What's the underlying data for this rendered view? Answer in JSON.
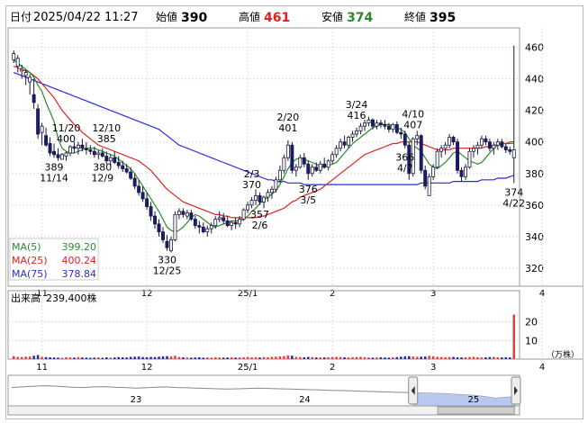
{
  "header": {
    "date_label": "日付",
    "date_value": "2025/04/22 11:27",
    "open_label": "始値",
    "open_value": "390",
    "high_label": "高値",
    "high_value": "461",
    "low_label": "安値",
    "low_value": "374",
    "close_label": "終値",
    "close_value": "395"
  },
  "colors": {
    "up": "#ffffff",
    "down": "#1a1a7a",
    "ma5": "#2a8a2a",
    "ma25": "#e02020",
    "ma75": "#2a2ae0",
    "high_text": "#e02020",
    "low_text": "#2a8a2a",
    "vol_up": "#e04040",
    "vol_down": "#2a2a9a",
    "nav_fill": "#b8c8f0"
  },
  "legend": [
    {
      "name": "MA(5)",
      "value": "399.20"
    },
    {
      "name": "MA(25)",
      "value": "400.24"
    },
    {
      "name": "MA(75)",
      "value": "378.84"
    }
  ],
  "volume_label": "出来高",
  "volume_value": "239,400株",
  "volume_unit": "（万株）",
  "month_ticks": [
    "11",
    "12",
    "25/1",
    "2",
    "3",
    "4"
  ],
  "nav_ticks": [
    "23",
    "24",
    "25"
  ],
  "chart_data": {
    "type": "candlestick",
    "ylim": [
      312,
      470
    ],
    "yticks": [
      320,
      340,
      360,
      380,
      400,
      420,
      440,
      460
    ],
    "volume_ylim": [
      0,
      30
    ],
    "volume_yticks": [
      10,
      20
    ],
    "month_start_index": [
      7,
      33,
      58,
      79,
      104,
      131
    ],
    "ohlc": [
      [
        452,
        458,
        450,
        456
      ],
      [
        448,
        455,
        444,
        453
      ],
      [
        445,
        449,
        440,
        446
      ],
      [
        442,
        446,
        436,
        444
      ],
      [
        438,
        443,
        430,
        441
      ],
      [
        430,
        440,
        421,
        425
      ],
      [
        421,
        424,
        402,
        405
      ],
      [
        406,
        412,
        398,
        410
      ],
      [
        404,
        409,
        397,
        398
      ],
      [
        399,
        403,
        391,
        393
      ],
      [
        394,
        399,
        390,
        392
      ],
      [
        392,
        396,
        388,
        390
      ],
      [
        389,
        393,
        389,
        392
      ],
      [
        391,
        394,
        388,
        393
      ],
      [
        393,
        398,
        391,
        397
      ],
      [
        397,
        400,
        393,
        396
      ],
      [
        396,
        400,
        392,
        398
      ],
      [
        398,
        402,
        394,
        396
      ],
      [
        396,
        400,
        392,
        395
      ],
      [
        395,
        398,
        392,
        394
      ],
      [
        394,
        397,
        390,
        392
      ],
      [
        392,
        395,
        389,
        393
      ],
      [
        393,
        396,
        390,
        391
      ],
      [
        391,
        394,
        386,
        388
      ],
      [
        388,
        392,
        385,
        390
      ],
      [
        390,
        394,
        386,
        387
      ],
      [
        387,
        391,
        383,
        385
      ],
      [
        385,
        388,
        381,
        383
      ],
      [
        383,
        386,
        380,
        381
      ],
      [
        381,
        384,
        376,
        377
      ],
      [
        377,
        380,
        370,
        372
      ],
      [
        372,
        376,
        366,
        368
      ],
      [
        368,
        372,
        362,
        364
      ],
      [
        364,
        368,
        357,
        359
      ],
      [
        359,
        362,
        350,
        353
      ],
      [
        353,
        356,
        345,
        348
      ],
      [
        348,
        351,
        340,
        343
      ],
      [
        343,
        346,
        336,
        338
      ],
      [
        337,
        341,
        331,
        333
      ],
      [
        331,
        340,
        330,
        338
      ],
      [
        338,
        356,
        337,
        354
      ],
      [
        354,
        358,
        351,
        356
      ],
      [
        356,
        358,
        352,
        354
      ],
      [
        353,
        357,
        351,
        355
      ],
      [
        355,
        357,
        350,
        351
      ],
      [
        351,
        353,
        345,
        347
      ],
      [
        347,
        350,
        342,
        346
      ],
      [
        346,
        349,
        342,
        343
      ],
      [
        343,
        347,
        340,
        345
      ],
      [
        345,
        349,
        342,
        347
      ],
      [
        347,
        353,
        345,
        351
      ],
      [
        351,
        356,
        349,
        352
      ],
      [
        352,
        355,
        348,
        350
      ],
      [
        350,
        353,
        346,
        347
      ],
      [
        347,
        350,
        344,
        349
      ],
      [
        349,
        352,
        345,
        348
      ],
      [
        348,
        353,
        346,
        351
      ],
      [
        351,
        358,
        350,
        357
      ],
      [
        357,
        362,
        355,
        360
      ],
      [
        360,
        365,
        358,
        363
      ],
      [
        363,
        370,
        360,
        366
      ],
      [
        366,
        368,
        360,
        362
      ],
      [
        362,
        366,
        358,
        365
      ],
      [
        365,
        370,
        362,
        368
      ],
      [
        368,
        372,
        364,
        370
      ],
      [
        370,
        378,
        368,
        376
      ],
      [
        376,
        385,
        374,
        382
      ],
      [
        382,
        392,
        380,
        390
      ],
      [
        390,
        401,
        388,
        398
      ],
      [
        398,
        400,
        380,
        382
      ],
      [
        382,
        386,
        378,
        384
      ],
      [
        384,
        392,
        383,
        390
      ],
      [
        390,
        393,
        384,
        386
      ],
      [
        386,
        388,
        376,
        380
      ],
      [
        380,
        386,
        378,
        384
      ],
      [
        384,
        387,
        381,
        382
      ],
      [
        382,
        388,
        380,
        386
      ],
      [
        386,
        390,
        383,
        384
      ],
      [
        384,
        389,
        382,
        388
      ],
      [
        388,
        394,
        386,
        392
      ],
      [
        392,
        398,
        390,
        396
      ],
      [
        396,
        402,
        394,
        400
      ],
      [
        400,
        404,
        396,
        398
      ],
      [
        398,
        404,
        396,
        403
      ],
      [
        403,
        407,
        400,
        405
      ],
      [
        405,
        409,
        403,
        407
      ],
      [
        407,
        412,
        405,
        410
      ],
      [
        410,
        414,
        407,
        412
      ],
      [
        412,
        416,
        410,
        414
      ],
      [
        414,
        415,
        408,
        410
      ],
      [
        410,
        414,
        408,
        412
      ],
      [
        412,
        414,
        409,
        411
      ],
      [
        411,
        414,
        408,
        410
      ],
      [
        410,
        412,
        406,
        408
      ],
      [
        408,
        412,
        406,
        411
      ],
      [
        411,
        413,
        405,
        406
      ],
      [
        406,
        409,
        402,
        405
      ],
      [
        405,
        407,
        396,
        398
      ],
      [
        398,
        400,
        376,
        380
      ],
      [
        380,
        403,
        378,
        402
      ],
      [
        402,
        407,
        398,
        404
      ],
      [
        404,
        405,
        380,
        382
      ],
      [
        382,
        385,
        370,
        372
      ],
      [
        366,
        380,
        366,
        378
      ],
      [
        378,
        386,
        376,
        384
      ],
      [
        384,
        396,
        383,
        394
      ],
      [
        394,
        398,
        390,
        396
      ],
      [
        396,
        400,
        392,
        398
      ],
      [
        398,
        405,
        396,
        403
      ],
      [
        403,
        404,
        398,
        400
      ],
      [
        400,
        402,
        380,
        382
      ],
      [
        382,
        384,
        375,
        378
      ],
      [
        378,
        386,
        376,
        384
      ],
      [
        384,
        396,
        383,
        394
      ],
      [
        394,
        398,
        390,
        396
      ],
      [
        396,
        400,
        392,
        398
      ],
      [
        398,
        404,
        396,
        402
      ],
      [
        402,
        404,
        398,
        400
      ],
      [
        400,
        402,
        394,
        396
      ],
      [
        396,
        400,
        392,
        398
      ],
      [
        398,
        402,
        395,
        400
      ],
      [
        400,
        402,
        396,
        397
      ],
      [
        397,
        399,
        393,
        395
      ],
      [
        395,
        397,
        392,
        394
      ],
      [
        390,
        461,
        374,
        395
      ]
    ],
    "volume": [
      1.6,
      1.2,
      1.1,
      1.3,
      1.4,
      1.8,
      2.2,
      1.2,
      1.1,
      1.0,
      0.9,
      0.8,
      0.7,
      1.0,
      0.9,
      0.8,
      1.1,
      0.9,
      0.8,
      0.7,
      0.8,
      0.9,
      0.7,
      1.0,
      0.8,
      0.9,
      1.1,
      1.0,
      0.9,
      1.2,
      1.3,
      1.4,
      1.1,
      1.0,
      1.2,
      1.1,
      1.3,
      1.5,
      1.6,
      1.4,
      1.8,
      1.2,
      1.0,
      0.9,
      0.8,
      0.9,
      1.0,
      0.8,
      0.9,
      0.8,
      1.0,
      0.9,
      0.8,
      0.9,
      1.0,
      0.8,
      0.9,
      1.0,
      1.1,
      0.9,
      1.0,
      0.9,
      1.1,
      1.0,
      1.2,
      1.3,
      1.5,
      1.6,
      2.0,
      1.8,
      1.2,
      1.1,
      1.0,
      1.2,
      1.1,
      0.9,
      1.0,
      0.9,
      1.0,
      1.1,
      1.2,
      1.1,
      1.0,
      0.9,
      1.0,
      1.1,
      1.2,
      1.0,
      0.9,
      0.8,
      0.9,
      1.0,
      0.9,
      0.8,
      1.0,
      1.1,
      1.3,
      1.5,
      1.6,
      1.4,
      1.2,
      1.3,
      1.4,
      1.8,
      1.5,
      1.2,
      1.1,
      1.0,
      1.1,
      1.2,
      1.0,
      0.9,
      1.0,
      1.1,
      1.2,
      1.0,
      0.9,
      1.0,
      1.1,
      1.2,
      1.0,
      0.9,
      1.0,
      0.9,
      23.9
    ],
    "ma5": [
      452,
      450,
      448,
      446,
      444,
      441,
      436,
      432,
      425,
      419,
      413,
      402,
      396,
      394,
      393,
      393,
      394,
      395,
      396,
      396,
      396,
      395,
      394,
      393,
      392,
      391,
      389,
      387,
      385,
      383,
      380,
      376,
      372,
      368,
      364,
      360,
      356,
      351,
      346,
      344,
      343,
      344,
      346,
      349,
      352,
      354,
      353,
      351,
      349,
      347,
      346,
      347,
      348,
      349,
      350,
      350,
      350,
      351,
      353,
      356,
      358,
      361,
      363,
      365,
      367,
      369,
      373,
      378,
      383,
      387,
      389,
      390,
      389,
      388,
      387,
      386,
      384,
      384,
      385,
      386,
      387,
      390,
      393,
      396,
      399,
      401,
      403,
      405,
      407,
      409,
      410,
      411,
      411,
      411,
      410,
      409,
      408,
      406,
      402,
      398,
      396,
      394,
      390,
      386,
      384,
      383,
      385,
      387,
      390,
      393,
      394,
      392,
      390,
      388,
      387,
      386,
      387,
      390,
      393,
      396,
      398,
      399,
      399,
      399,
      399.2
    ],
    "ma25": [
      448,
      447,
      446,
      445,
      444,
      442,
      440,
      437,
      434,
      431,
      428,
      424,
      420,
      417,
      414,
      411,
      409,
      406,
      404,
      402,
      400,
      398,
      397,
      396,
      395,
      394,
      393,
      392,
      391,
      390,
      389,
      388,
      386,
      384,
      382,
      379,
      376,
      373,
      370,
      368,
      366,
      364,
      362,
      361,
      360,
      359,
      358,
      357,
      356,
      355,
      354,
      354,
      353,
      353,
      352,
      352,
      352,
      352,
      352,
      352,
      352,
      353,
      353,
      354,
      355,
      356,
      357,
      358,
      360,
      362,
      363,
      365,
      366,
      367,
      368,
      369,
      370,
      372,
      374,
      376,
      378,
      380,
      382,
      384,
      386,
      388,
      390,
      392,
      393,
      394,
      395,
      396,
      397,
      398,
      399,
      399,
      400,
      400,
      400,
      400,
      400,
      399,
      398,
      397,
      396,
      395,
      395,
      395,
      395,
      396,
      396,
      396,
      396,
      396,
      396,
      396,
      396,
      397,
      397,
      398,
      398,
      399,
      399,
      400,
      400.24
    ],
    "ma75": [
      444,
      443,
      442,
      441,
      440,
      439,
      438,
      437,
      436,
      435,
      434,
      433,
      432,
      431,
      430,
      429,
      428,
      427,
      426,
      425,
      424,
      423,
      422,
      421,
      420,
      419,
      418,
      417,
      416,
      415,
      414,
      413,
      412,
      411,
      410,
      409,
      408,
      406,
      404,
      402,
      400,
      398,
      397,
      396,
      395,
      394,
      393,
      392,
      391,
      390,
      389,
      388,
      387,
      386,
      385,
      384,
      383,
      382,
      381,
      380,
      379,
      378,
      377,
      376,
      376,
      375,
      375,
      375,
      374,
      374,
      374,
      374,
      373,
      373,
      373,
      373,
      373,
      373,
      373,
      373,
      373,
      373,
      373,
      373,
      373,
      373,
      373,
      373,
      373,
      373,
      373,
      373,
      373,
      373,
      373,
      373,
      373,
      373,
      373,
      373,
      373,
      374,
      374,
      374,
      374,
      374,
      374,
      374,
      374,
      375,
      375,
      375,
      375,
      375,
      375,
      375,
      376,
      376,
      376,
      376,
      377,
      377,
      377,
      378,
      378.84
    ],
    "annotations": [
      {
        "index": 10,
        "text": "389",
        "sub": "11/14",
        "pos": "below"
      },
      {
        "index": 13,
        "text": "11/20",
        "sub": "400",
        "pos": "above"
      },
      {
        "index": 23,
        "text": "12/10",
        "sub": "385",
        "pos": "above"
      },
      {
        "index": 22,
        "text": "380",
        "sub": "12/9",
        "pos": "below"
      },
      {
        "index": 38,
        "text": "330",
        "sub": "12/25",
        "pos": "below"
      },
      {
        "index": 59,
        "text": "2/3",
        "sub": "370",
        "pos": "above"
      },
      {
        "index": 61,
        "text": "357",
        "sub": "2/6",
        "pos": "below"
      },
      {
        "index": 68,
        "text": "2/20",
        "sub": "401",
        "pos": "above"
      },
      {
        "index": 73,
        "text": "376",
        "sub": "3/5",
        "pos": "below"
      },
      {
        "index": 85,
        "text": "3/24",
        "sub": "416",
        "pos": "above"
      },
      {
        "index": 97,
        "text": "366",
        "sub": "4/7",
        "pos": "below"
      },
      {
        "index": 99,
        "text": "4/10",
        "sub": "407",
        "pos": "above"
      },
      {
        "index": 124,
        "text": "374",
        "sub": "4/22",
        "pos": "below"
      }
    ],
    "navigator": [
      60,
      62,
      64,
      66,
      65,
      63,
      61,
      60,
      62,
      63,
      61,
      60,
      58,
      59,
      61,
      62,
      60,
      59,
      58,
      57,
      56,
      55,
      56,
      57,
      58,
      57,
      56,
      55,
      54,
      53,
      52,
      51,
      50,
      49,
      48,
      47,
      46,
      45,
      44,
      43,
      42,
      41,
      40,
      38,
      36,
      34,
      30,
      25,
      28,
      30
    ],
    "nav_ylim": [
      0,
      100
    ]
  }
}
